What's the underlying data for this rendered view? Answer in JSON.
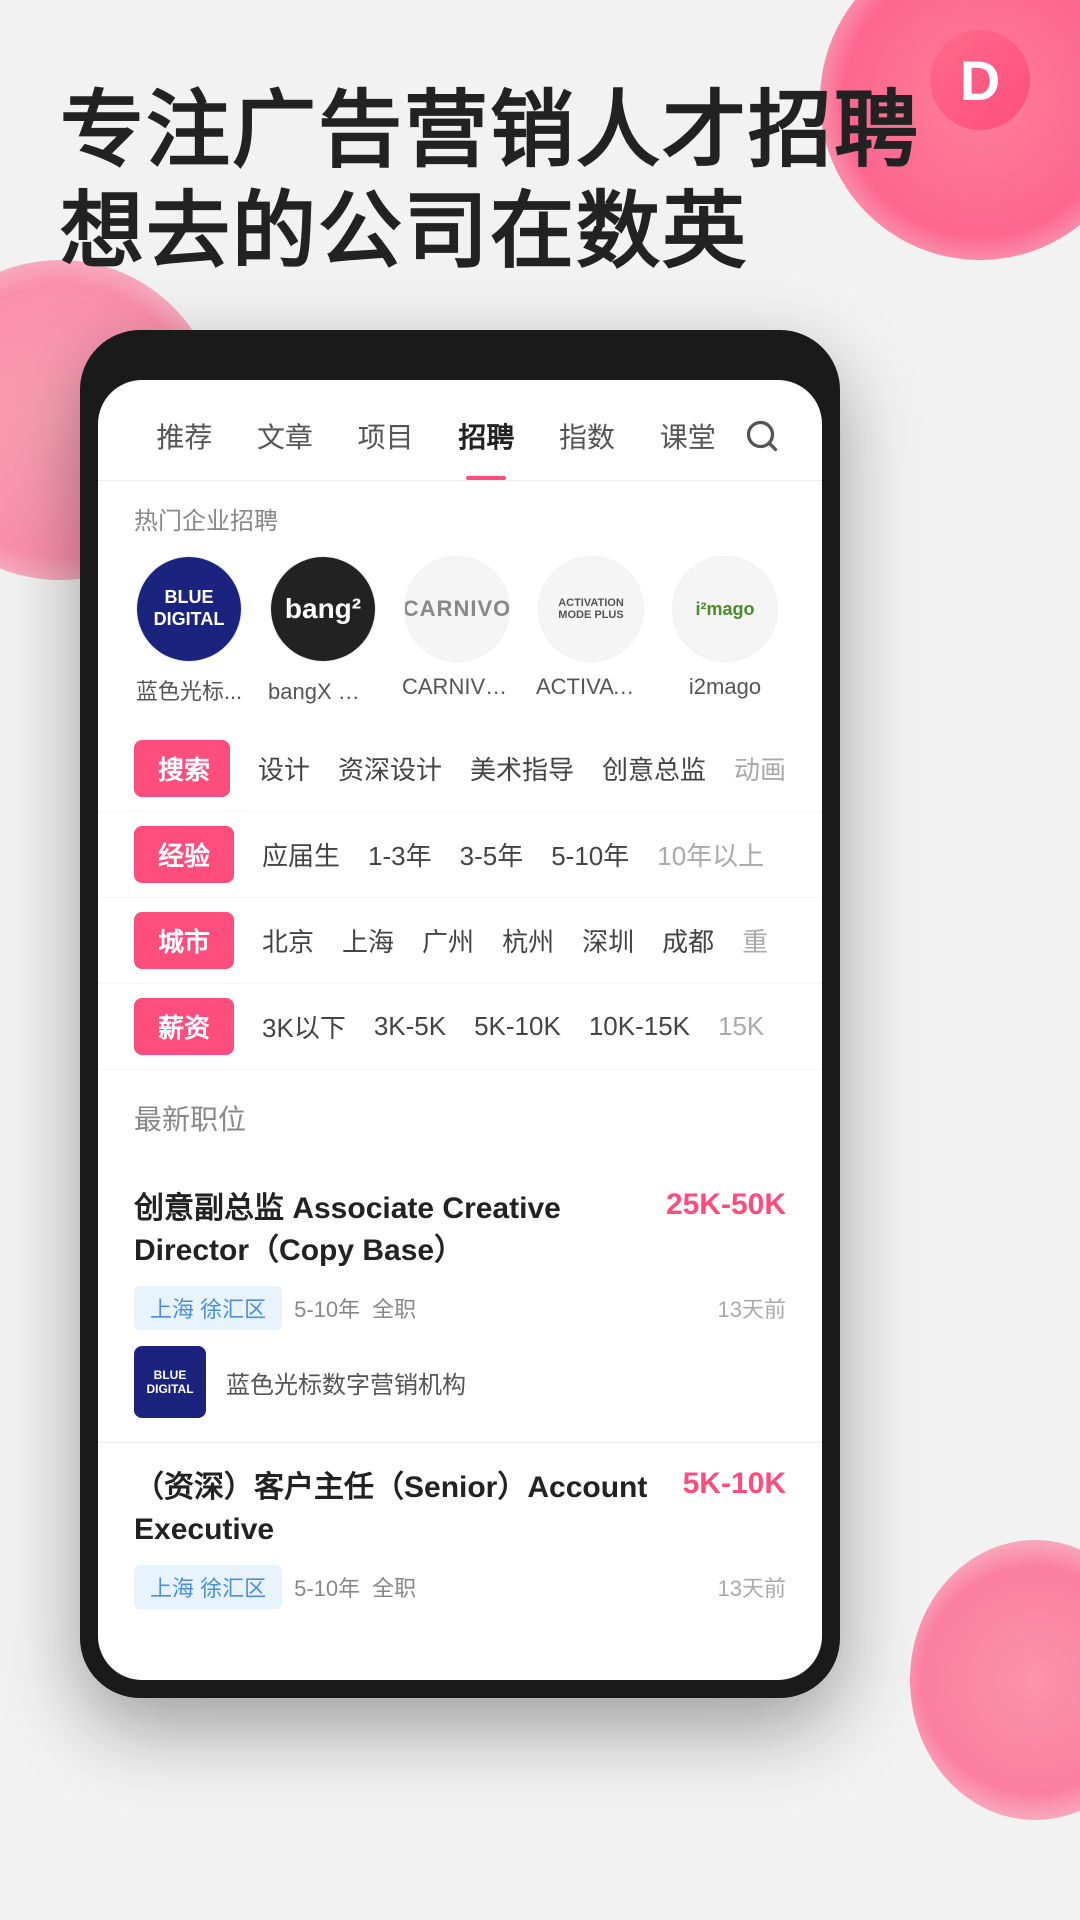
{
  "app": {
    "logo_letter": "D"
  },
  "hero": {
    "line1": "专注广告营销人才招聘",
    "line2": "想去的公司在数英"
  },
  "nav": {
    "items": [
      {
        "label": "推荐",
        "active": false
      },
      {
        "label": "文章",
        "active": false
      },
      {
        "label": "项目",
        "active": false
      },
      {
        "label": "招聘",
        "active": true
      },
      {
        "label": "指数",
        "active": false
      },
      {
        "label": "课堂",
        "active": false
      }
    ],
    "search_icon": "🔍"
  },
  "hot_companies": {
    "section_label": "热门企业招聘",
    "items": [
      {
        "name": "蓝色光标...",
        "logo_text": "BLUE\nDIGITAL",
        "logo_type": "blue_digital"
      },
      {
        "name": "bangX 上海",
        "logo_text": "bang²",
        "logo_type": "bangx"
      },
      {
        "name": "CARNIVO...",
        "logo_text": "CARNIVO",
        "logo_type": "carnivo"
      },
      {
        "name": "ACTIVATIO...",
        "logo_text": "ACTIVATION\nMODE PLUS",
        "logo_type": "activation"
      },
      {
        "name": "i2mago",
        "logo_text": "i²mago",
        "logo_type": "i2mago"
      }
    ]
  },
  "filters": [
    {
      "tag": "搜索",
      "options": [
        "设计",
        "资深设计",
        "美术指导",
        "创意总监",
        "动画"
      ]
    },
    {
      "tag": "经验",
      "options": [
        "应届生",
        "1-3年",
        "3-5年",
        "5-10年",
        "10年以上"
      ]
    },
    {
      "tag": "城市",
      "options": [
        "北京",
        "上海",
        "广州",
        "杭州",
        "深圳",
        "成都",
        "重"
      ]
    },
    {
      "tag": "薪资",
      "options": [
        "3K以下",
        "3K-5K",
        "5K-10K",
        "10K-15K",
        "15K"
      ]
    }
  ],
  "latest_jobs": {
    "section_title": "最新职位",
    "jobs": [
      {
        "title": "创意副总监 Associate Creative Director（Copy Base）",
        "salary": "25K-50K",
        "location": "上海 徐汇区",
        "experience": "5-10年",
        "type": "全职",
        "time": "13天前",
        "company_name": "蓝色光标数字营销机构",
        "company_logo_text": "BLUE\nDIGITAL"
      },
      {
        "title": "（资深）客户主任（Senior）Account Executive",
        "salary": "5K-10K",
        "location": "上海 徐汇区",
        "experience": "5-10年",
        "type": "全职",
        "time": "13天前",
        "company_name": "",
        "company_logo_text": ""
      }
    ]
  }
}
